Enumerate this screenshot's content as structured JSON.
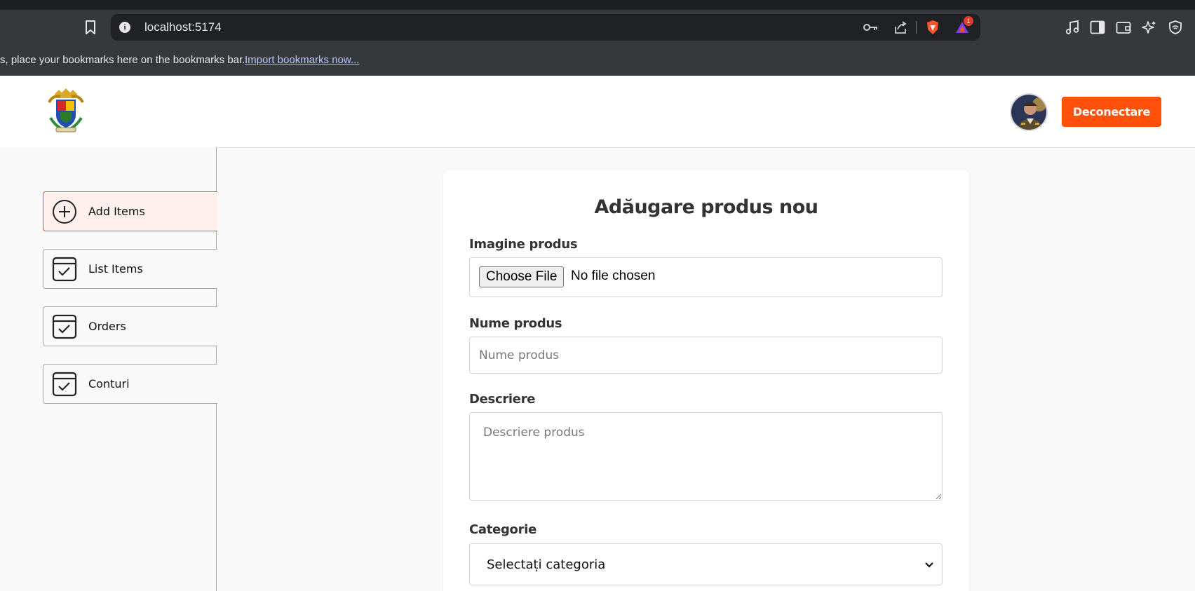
{
  "browser": {
    "url": "localhost:5174",
    "bookmarks_bar": {
      "message": "s, place your bookmarks here on the bookmarks bar.",
      "import_link": "Import bookmarks now..."
    },
    "notification_count": "1"
  },
  "header": {
    "logout_label": "Deconectare"
  },
  "sidebar": {
    "items": [
      {
        "label": "Add Items",
        "icon": "add-circle-icon",
        "active": true
      },
      {
        "label": "List Items",
        "icon": "checklist-icon",
        "active": false
      },
      {
        "label": "Orders",
        "icon": "checklist-icon",
        "active": false
      },
      {
        "label": "Conturi",
        "icon": "checklist-icon",
        "active": false
      }
    ]
  },
  "form": {
    "title": "Adăugare produs nou",
    "image_label": "Imagine produs",
    "file_button": "Choose File",
    "file_status": "No file chosen",
    "name_label": "Nume produs",
    "name_placeholder": "Nume produs",
    "description_label": "Descriere",
    "description_placeholder": "Descriere produs",
    "category_label": "Categorie",
    "category_selected": "Selectați categoria"
  },
  "colors": {
    "accent": "#fe4f0b",
    "active_bg": "#fff0ed",
    "chrome_bg": "#37383c"
  }
}
